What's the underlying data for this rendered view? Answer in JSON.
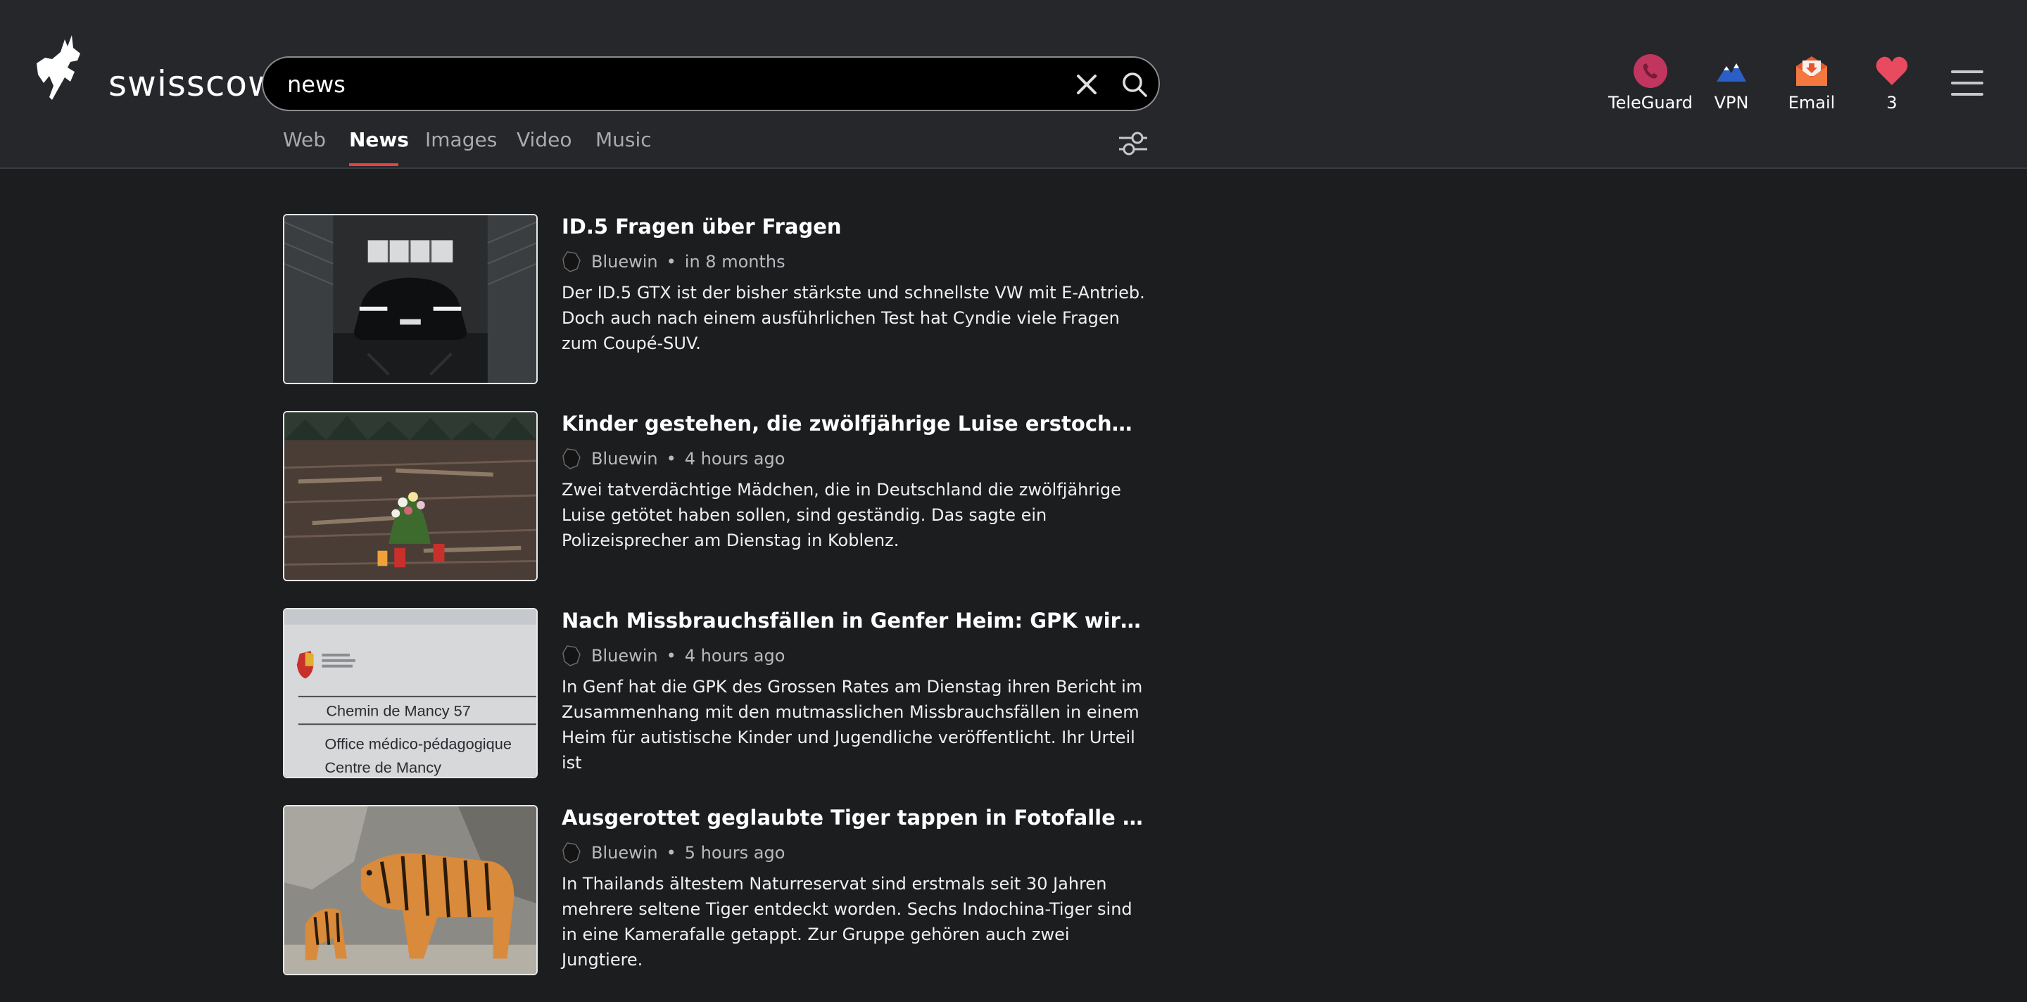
{
  "brand": {
    "name": "swisscows"
  },
  "search": {
    "query": "news",
    "placeholder": ""
  },
  "tabs": [
    {
      "label": "Web"
    },
    {
      "label": "News"
    },
    {
      "label": "Images"
    },
    {
      "label": "Video"
    },
    {
      "label": "Music"
    }
  ],
  "active_tab": "News",
  "apps": [
    {
      "label": "TeleGuard",
      "icon": "teleguard-icon"
    },
    {
      "label": "VPN",
      "icon": "vpn-icon"
    },
    {
      "label": "Email",
      "icon": "email-icon"
    },
    {
      "label": "3",
      "icon": "heart-icon"
    }
  ],
  "colors": {
    "accent": "#e8413b",
    "header_bg": "#25272a",
    "page_bg": "#1c1d1f"
  },
  "results": [
    {
      "title": "ID.5 Fragen über Fragen",
      "source": "Bluewin",
      "time": "in 8 months",
      "description": "Der ID.5 GTX ist der bisher stärkste und schnellste VW mit E-Antrieb. Doch auch nach einem ausführlichen Test hat Cyndie viele Fragen zum Coupé-SUV.",
      "image": "car-in-garage-image"
    },
    {
      "title": "Kinder gestehen, die zwölfjährige Luise erstochen zu haben",
      "source": "Bluewin",
      "time": "4 hours ago",
      "description": "Zwei tatverdächtige Mädchen, die in Deutschland die zwölfjährige Luise getötet haben sollen, sind geständig. Das sagte ein Polizeisprecher am Dienstag in Koblenz.",
      "image": "flowers-candles-forest-image"
    },
    {
      "title": "Nach Missbrauchsfällen in Genfer Heim: GPK wirft Staat Versag...",
      "source": "Bluewin",
      "time": "4 hours ago",
      "description": "In Genf hat die GPK des Grossen Rates am Dienstag ihren Bericht im Zusammenhang mit den mutmasslichen Missbrauchsfällen in einem Heim für autistische Kinder und Jugendliche veröffentlicht. Ihr Urteil ist",
      "image": "building-sign-image",
      "image_text": [
        "Chemin de Mancy 57",
        "Office médico-pédagogique",
        "Centre de Mancy"
      ]
    },
    {
      "title": "Ausgerottet geglaubte Tiger tappen in Fotofalle – samt Jungen",
      "source": "Bluewin",
      "time": "5 hours ago",
      "description": "In Thailands ältestem Naturreservat sind erstmals seit 30 Jahren mehrere seltene Tiger entdeckt worden. Sechs Indochina-Tiger sind in eine Kamerafalle getappt. Zur Gruppe gehören auch zwei Jungtiere.",
      "image": "tigers-image"
    }
  ]
}
